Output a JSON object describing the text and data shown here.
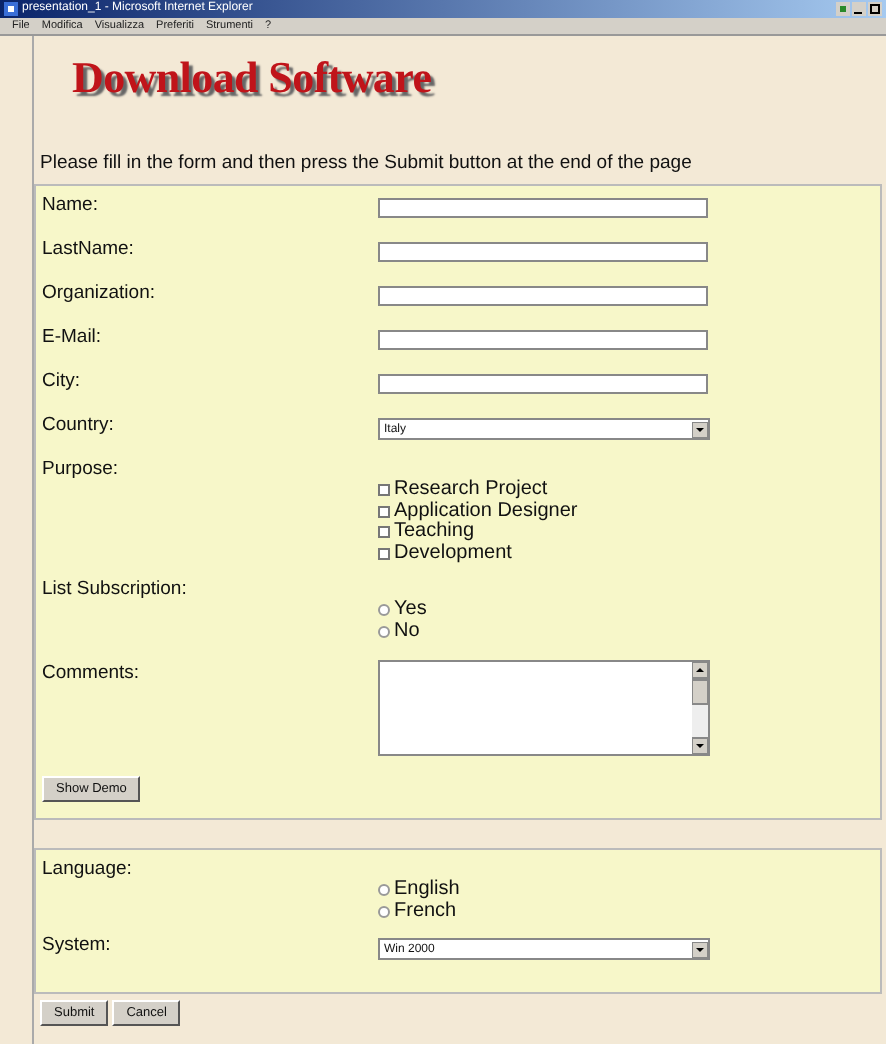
{
  "window": {
    "title": "presentation_1 - Microsoft Internet Explorer"
  },
  "menu": [
    "File",
    "Modifica",
    "Visualizza",
    "Preferiti",
    "Strumenti",
    "?"
  ],
  "heading": "Download Software",
  "instructions": "Please fill in the form and then press the Submit button at the end of the page",
  "form": {
    "fields": [
      {
        "kind": "text",
        "label": "Name:"
      },
      {
        "kind": "text",
        "label": "LastName:"
      },
      {
        "kind": "text",
        "label": "Organization:"
      },
      {
        "kind": "text",
        "label": "E-Mail:"
      },
      {
        "kind": "text",
        "label": "City:"
      },
      {
        "kind": "select",
        "label": "Country:",
        "value": "Italy"
      },
      {
        "kind": "checkboxes",
        "label": "Purpose:",
        "options": [
          {
            "label": "Research Project",
            "checked": false
          },
          {
            "label": "Application Designer",
            "checked": false
          },
          {
            "label": "Teaching",
            "checked": false
          },
          {
            "label": "Development",
            "checked": false
          }
        ]
      },
      {
        "kind": "radios",
        "label": "List Subscription:",
        "options": [
          {
            "label": "Yes",
            "selected": false
          },
          {
            "label": "No",
            "selected": false
          }
        ]
      },
      {
        "kind": "textarea",
        "label": "Comments:"
      }
    ],
    "button": "Show Demo"
  },
  "settings": {
    "fields": [
      {
        "kind": "radios",
        "label": "Language:",
        "options": [
          {
            "label": "English",
            "selected": false
          },
          {
            "label": "French",
            "selected": false
          }
        ]
      },
      {
        "kind": "select",
        "label": "System:",
        "value": "Win 2000"
      }
    ]
  },
  "buttons": [
    "Submit",
    "Cancel"
  ]
}
